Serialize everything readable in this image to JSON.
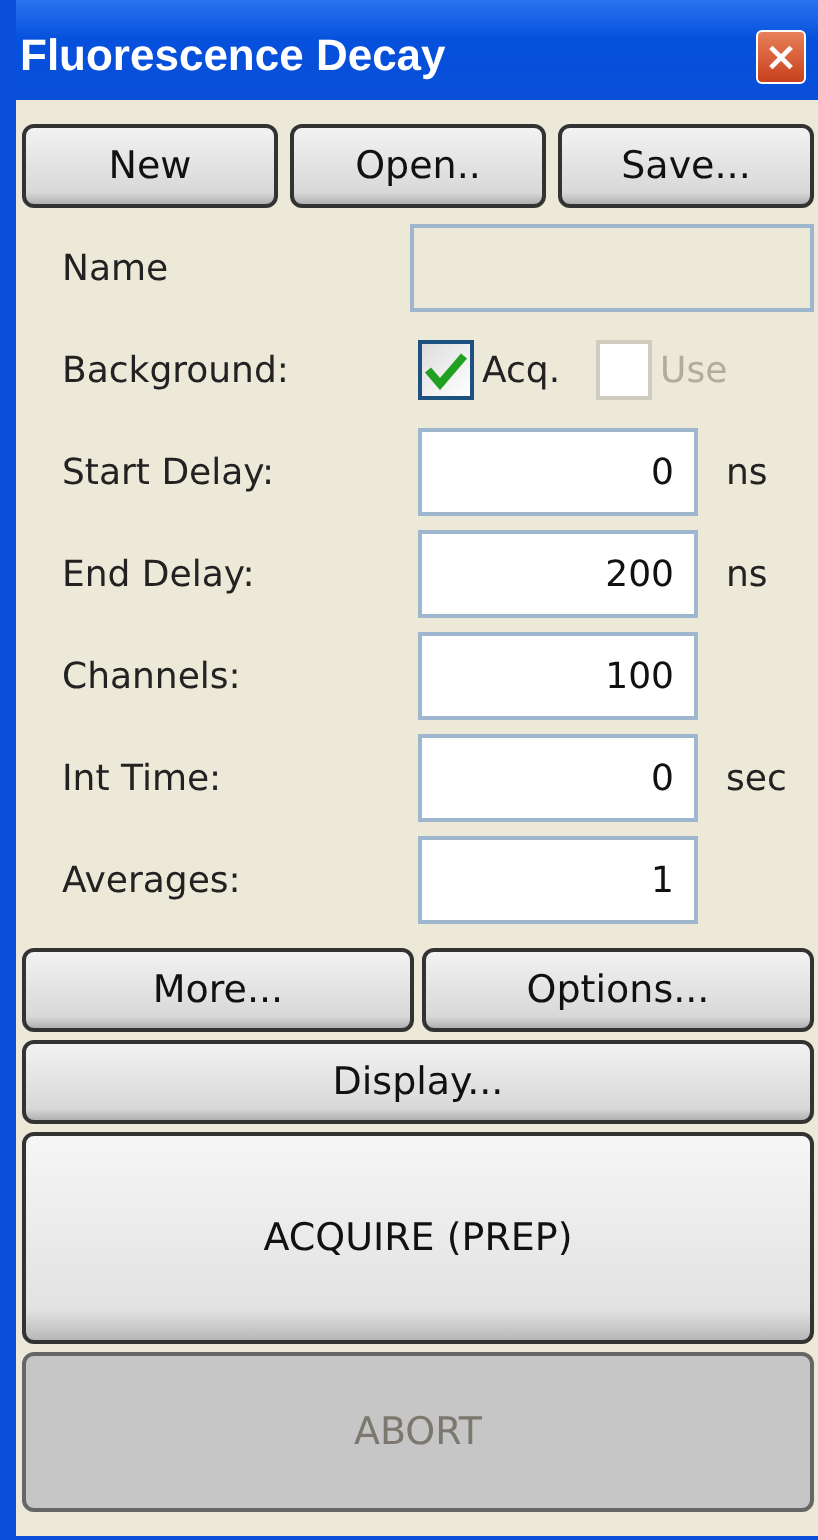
{
  "window": {
    "title": "Fluorescence Decay",
    "close": "×"
  },
  "file_buttons": [
    {
      "label": "New"
    },
    {
      "label": "Open.."
    },
    {
      "label": "Save..."
    }
  ],
  "fields": [
    {
      "kind": "text",
      "label": "Name",
      "disabled": true
    },
    {
      "kind": "checkboxes",
      "label": "Background:",
      "options": [
        {
          "label": "Acq.",
          "checked": true,
          "disabled": false
        },
        {
          "label": "Use",
          "checked": false,
          "disabled": true
        }
      ]
    },
    {
      "kind": "number",
      "label": "Start Delay:",
      "value": "0",
      "unit": "ns"
    },
    {
      "kind": "number",
      "label": "End Delay:",
      "value": "200",
      "unit": "ns"
    },
    {
      "kind": "number",
      "label": "Channels:",
      "value": "100"
    },
    {
      "kind": "number",
      "label": "Int Time:",
      "value": "0",
      "unit": "sec"
    },
    {
      "kind": "number",
      "label": "Averages:",
      "value": "1"
    }
  ],
  "option_buttons": [
    {
      "label": "More..."
    },
    {
      "label": "Options..."
    }
  ],
  "display_button": {
    "label": "Display..."
  },
  "acquire_button": {
    "label": "ACQUIRE (PREP)",
    "disabled": false
  },
  "abort_button": {
    "label": "ABORT",
    "disabled": true
  }
}
